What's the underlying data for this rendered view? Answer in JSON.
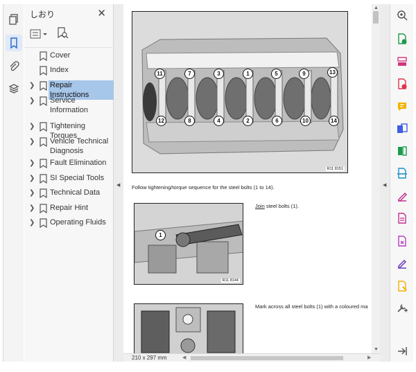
{
  "left_toolbar": {
    "items": [
      {
        "name": "pages-thumbnails",
        "icon": "pages-icon",
        "active": false
      },
      {
        "name": "bookmarks",
        "icon": "bookmark-icon",
        "active": true
      },
      {
        "name": "attachments",
        "icon": "paperclip-icon",
        "active": false
      },
      {
        "name": "layers",
        "icon": "layers-icon",
        "active": false
      }
    ]
  },
  "bookmarks_panel": {
    "title": "しおり",
    "close_glyph": "✕",
    "items": [
      {
        "label": "Cover",
        "expandable": false,
        "selected": false
      },
      {
        "label": "Index",
        "expandable": false,
        "selected": false
      },
      {
        "label": "Repair Instructions",
        "expandable": true,
        "selected": true
      },
      {
        "label": "Service Information",
        "expandable": true,
        "selected": false
      },
      {
        "label": "Tightening Torques",
        "expandable": true,
        "selected": false
      },
      {
        "label": "Vehicle Technical Diagnosis",
        "expandable": true,
        "selected": false
      },
      {
        "label": "Fault Elimination",
        "expandable": true,
        "selected": false
      },
      {
        "label": "SI Special Tools",
        "expandable": true,
        "selected": false
      },
      {
        "label": "Technical Data",
        "expandable": true,
        "selected": false
      },
      {
        "label": "Repair Hint",
        "expandable": true,
        "selected": false
      },
      {
        "label": "Operating Fluids",
        "expandable": true,
        "selected": false
      }
    ]
  },
  "document": {
    "figure1": {
      "ref": "R11 8151",
      "bolts_top": [
        "11",
        "7",
        "3",
        "1",
        "5",
        "9",
        "13"
      ],
      "bolts_bottom": [
        "12",
        "8",
        "4",
        "2",
        "6",
        "10",
        "14"
      ]
    },
    "caption1": "Follow tightening/torque sequence for the steel bolts (1 to 14).",
    "figure2": {
      "ref": "R11 8144",
      "bolt": "1"
    },
    "caption2": {
      "link": "Join",
      "rest": " steel bolts (1)."
    },
    "caption3": "Mark across all steel bolts (1) with a coloured ma"
  },
  "status_bar": {
    "page_size": "210 x 297 mm"
  },
  "right_toolbar": {
    "items": [
      {
        "name": "zoom",
        "icon": "zoom-icon",
        "color": "#555555"
      },
      {
        "name": "export-pdf",
        "icon": "export-pdf-icon",
        "color": "#1a9b4b"
      },
      {
        "name": "organize-pages",
        "icon": "organize-pages-icon",
        "color": "#d4357d"
      },
      {
        "name": "create-pdf",
        "icon": "create-pdf-icon",
        "color": "#e0334a"
      },
      {
        "name": "comment",
        "icon": "comment-icon",
        "color": "#f2b200"
      },
      {
        "name": "combine-files",
        "icon": "combine-files-icon",
        "color": "#3f5ee0"
      },
      {
        "name": "compress",
        "icon": "compress-icon",
        "color": "#1a9b4b"
      },
      {
        "name": "scan",
        "icon": "scan-icon",
        "color": "#1b91c9"
      },
      {
        "name": "fill-sign",
        "icon": "fill-sign-icon",
        "color": "#c2308f"
      },
      {
        "name": "edit-pdf",
        "icon": "edit-pdf-icon",
        "color": "#c2308f"
      },
      {
        "name": "protect",
        "icon": "protect-icon",
        "color": "#b23fbf"
      },
      {
        "name": "request-signature",
        "icon": "request-signature-icon",
        "color": "#6b3fbf"
      },
      {
        "name": "redact",
        "icon": "redact-icon",
        "color": "#f2b200"
      },
      {
        "name": "more-tools",
        "icon": "more-tools-icon",
        "color": "#555555"
      },
      {
        "name": "collapse-panel",
        "icon": "collapse-arrow-icon",
        "color": "#555555"
      }
    ]
  }
}
